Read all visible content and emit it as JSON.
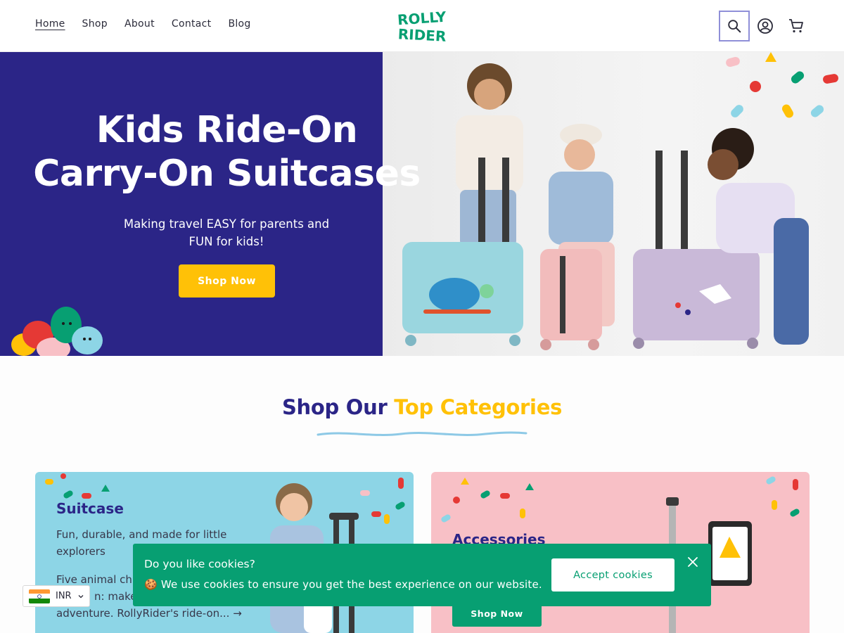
{
  "nav": {
    "items": [
      {
        "label": "Home",
        "active": true
      },
      {
        "label": "Shop"
      },
      {
        "label": "About"
      },
      {
        "label": "Contact"
      },
      {
        "label": "Blog"
      }
    ]
  },
  "logo": {
    "line1": "ROLLY",
    "line2": "RIDER",
    "color": "#079f72"
  },
  "header_icons": {
    "search": "search-icon",
    "account": "account-icon",
    "cart": "cart-icon"
  },
  "hero": {
    "title": "Kids Ride-On Carry-On Suitcases",
    "subtitle": "Making travel EASY for parents and FUN for kids!",
    "cta": "Shop Now"
  },
  "categories": {
    "heading_part1": "Shop Our",
    "heading_part2": "Top Categories",
    "cards": [
      {
        "title": "Suitcase",
        "text1": "Fun, durable, and made for little explorers",
        "text2_line1": "Five animal ch",
        "text2_line2": "n: make",
        "text2_line3": "adventure. RollyRider's ride-on... →"
      },
      {
        "title": "Accessories",
        "cta": "Shop Now"
      }
    ]
  },
  "cookie": {
    "title": "Do you like cookies?",
    "text": "🍪 We use cookies to ensure you get the best experience on our website.",
    "accept": "Accept cookies"
  },
  "currency": {
    "code": "INR"
  },
  "colors": {
    "brand_navy": "#2b2587",
    "brand_yellow": "#ffc107",
    "brand_green": "#079f72",
    "card_blue": "#8dd5e6",
    "card_pink": "#f8c0c6"
  }
}
